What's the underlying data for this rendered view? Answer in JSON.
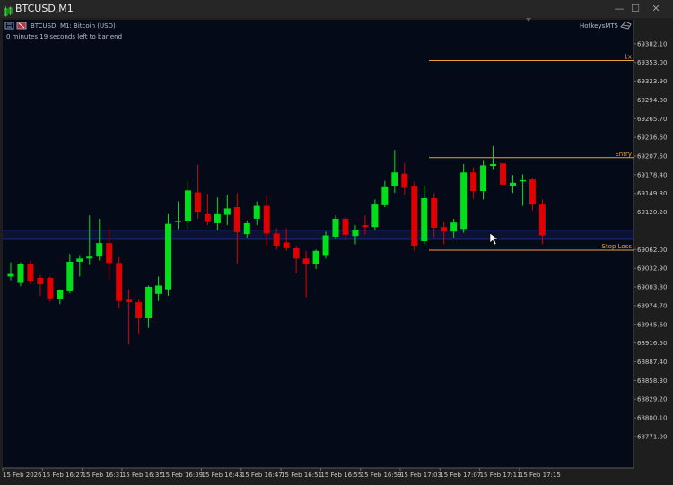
{
  "window": {
    "title": "BTCUSD,M1",
    "minimize_glyph": "—",
    "maximize_glyph": "☐",
    "close_glyph": "✕"
  },
  "chart": {
    "symbol_line": "BTCUSD, M1:  Bitcoin (USD)",
    "timer_text": "0 minutes 19 seconds left to bar end",
    "plugin_label": "HotkeysMT5",
    "icons": [
      "bars-icon",
      "robot-icon",
      "hat-icon",
      "mouse-cursor-icon"
    ],
    "colors": {
      "background": "#050a19",
      "bull": "#00e01a",
      "bear": "#e00000",
      "level": "#e8a33a",
      "band": "#1f2a80"
    }
  },
  "chart_data": {
    "type": "candlestick",
    "ylim": [
      68750,
      69400
    ],
    "y_ticks": [
      "69382.10",
      "69353.00",
      "69323.90",
      "69294.80",
      "69265.70",
      "69236.60",
      "69207.50",
      "69178.40",
      "69149.30",
      "69120.20",
      "69062.00",
      "69032.90",
      "69003.80",
      "68974.70",
      "68945.60",
      "68916.50",
      "68887.40",
      "68858.30",
      "68829.20",
      "68800.10",
      "68771.00"
    ],
    "x_ticks": [
      "15 Feb 2026",
      "15 Feb 16:27",
      "15 Feb 16:31",
      "15 Feb 16:35",
      "15 Feb 16:39",
      "15 Feb 16:43",
      "15 Feb 16:47",
      "15 Feb 16:51",
      "15 Feb 16:55",
      "15 Feb 16:59",
      "15 Feb 17:03",
      "15 Feb 17:07",
      "15 Feb 17:11",
      "15 Feb 17:15"
    ],
    "levels": [
      {
        "label": "1x",
        "price": 69356
      },
      {
        "label": "Entry",
        "price": 69205
      },
      {
        "label": "Stop Loss",
        "price": 69061
      }
    ],
    "bid_ask_band": [
      69078,
      69092
    ],
    "candles": [
      {
        "o": 69020,
        "h": 69042,
        "l": 69014,
        "c": 69024
      },
      {
        "o": 69010,
        "h": 69042,
        "l": 69005,
        "c": 69040
      },
      {
        "o": 69039,
        "h": 69045,
        "l": 69008,
        "c": 69013
      },
      {
        "o": 69018,
        "h": 69022,
        "l": 68990,
        "c": 69008
      },
      {
        "o": 69018,
        "h": 69020,
        "l": 68981,
        "c": 68986
      },
      {
        "o": 68985,
        "h": 69000,
        "l": 68977,
        "c": 68999
      },
      {
        "o": 68997,
        "h": 69055,
        "l": 68994,
        "c": 69043
      },
      {
        "o": 69043,
        "h": 69052,
        "l": 69020,
        "c": 69048
      },
      {
        "o": 69048,
        "h": 69115,
        "l": 69038,
        "c": 69051
      },
      {
        "o": 69051,
        "h": 69110,
        "l": 69045,
        "c": 69072
      },
      {
        "o": 69072,
        "h": 69095,
        "l": 69015,
        "c": 69041
      },
      {
        "o": 69041,
        "h": 69050,
        "l": 68970,
        "c": 68982
      },
      {
        "o": 68984,
        "h": 69000,
        "l": 68914,
        "c": 68980
      },
      {
        "o": 68980,
        "h": 68984,
        "l": 68930,
        "c": 68955
      },
      {
        "o": 68955,
        "h": 69006,
        "l": 68940,
        "c": 69004
      },
      {
        "o": 68993,
        "h": 69020,
        "l": 68982,
        "c": 69006
      },
      {
        "o": 69000,
        "h": 69117,
        "l": 68990,
        "c": 69102
      },
      {
        "o": 69106,
        "h": 69137,
        "l": 69094,
        "c": 69107
      },
      {
        "o": 69107,
        "h": 69168,
        "l": 69094,
        "c": 69154
      },
      {
        "o": 69151,
        "h": 69194,
        "l": 69110,
        "c": 69120
      },
      {
        "o": 69117,
        "h": 69149,
        "l": 69100,
        "c": 69105
      },
      {
        "o": 69103,
        "h": 69143,
        "l": 69092,
        "c": 69117
      },
      {
        "o": 69116,
        "h": 69147,
        "l": 69100,
        "c": 69126
      },
      {
        "o": 69128,
        "h": 69150,
        "l": 69040,
        "c": 69089
      },
      {
        "o": 69086,
        "h": 69107,
        "l": 69080,
        "c": 69103
      },
      {
        "o": 69110,
        "h": 69137,
        "l": 69100,
        "c": 69130
      },
      {
        "o": 69130,
        "h": 69145,
        "l": 69068,
        "c": 69087
      },
      {
        "o": 69087,
        "h": 69095,
        "l": 69062,
        "c": 69068
      },
      {
        "o": 69073,
        "h": 69095,
        "l": 69060,
        "c": 69064
      },
      {
        "o": 69064,
        "h": 69068,
        "l": 69025,
        "c": 69048
      },
      {
        "o": 69048,
        "h": 69060,
        "l": 68988,
        "c": 69040
      },
      {
        "o": 69040,
        "h": 69062,
        "l": 69032,
        "c": 69060
      },
      {
        "o": 69052,
        "h": 69090,
        "l": 69048,
        "c": 69084
      },
      {
        "o": 69082,
        "h": 69115,
        "l": 69078,
        "c": 69110
      },
      {
        "o": 69110,
        "h": 69113,
        "l": 69076,
        "c": 69085
      },
      {
        "o": 69083,
        "h": 69100,
        "l": 69070,
        "c": 69092
      },
      {
        "o": 69100,
        "h": 69115,
        "l": 69085,
        "c": 69097
      },
      {
        "o": 69097,
        "h": 69140,
        "l": 69092,
        "c": 69132
      },
      {
        "o": 69131,
        "h": 69169,
        "l": 69128,
        "c": 69159
      },
      {
        "o": 69160,
        "h": 69217,
        "l": 69150,
        "c": 69182
      },
      {
        "o": 69180,
        "h": 69196,
        "l": 69147,
        "c": 69158
      },
      {
        "o": 69160,
        "h": 69168,
        "l": 69060,
        "c": 69068
      },
      {
        "o": 69075,
        "h": 69162,
        "l": 69070,
        "c": 69142
      },
      {
        "o": 69142,
        "h": 69150,
        "l": 69080,
        "c": 69096
      },
      {
        "o": 69097,
        "h": 69105,
        "l": 69070,
        "c": 69090
      },
      {
        "o": 69090,
        "h": 69110,
        "l": 69080,
        "c": 69104
      },
      {
        "o": 69094,
        "h": 69195,
        "l": 69088,
        "c": 69182
      },
      {
        "o": 69182,
        "h": 69190,
        "l": 69141,
        "c": 69153
      },
      {
        "o": 69153,
        "h": 69200,
        "l": 69140,
        "c": 69193
      },
      {
        "o": 69192,
        "h": 69223,
        "l": 69186,
        "c": 69195
      },
      {
        "o": 69196,
        "h": 69197,
        "l": 69162,
        "c": 69163
      },
      {
        "o": 69160,
        "h": 69178,
        "l": 69150,
        "c": 69166
      },
      {
        "o": 69168,
        "h": 69179,
        "l": 69130,
        "c": 69170
      },
      {
        "o": 69171,
        "h": 69173,
        "l": 69123,
        "c": 69132
      },
      {
        "o": 69132,
        "h": 69140,
        "l": 69070,
        "c": 69084
      }
    ]
  }
}
